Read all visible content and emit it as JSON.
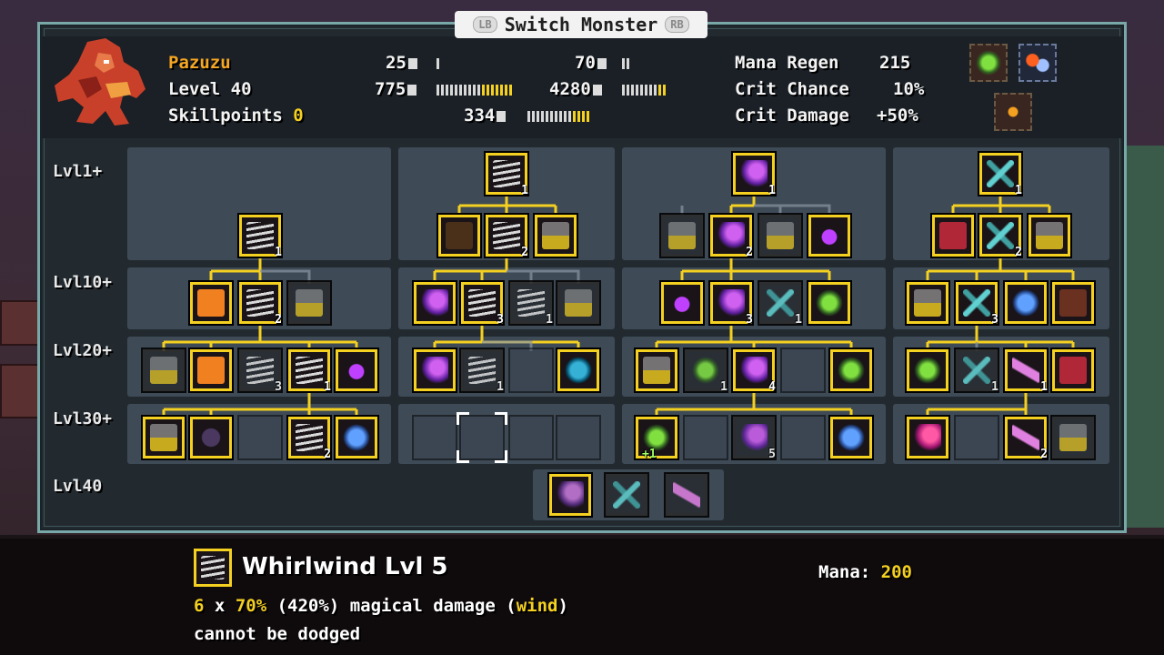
{
  "switch_bar": {
    "left_button": "LB",
    "label": "Switch Monster",
    "right_button": "RB"
  },
  "monster": {
    "name": "Pazuzu",
    "level_label": "Level 40",
    "skillpoints_label": "Skillpoints",
    "skillpoints_value": "0"
  },
  "stats": {
    "attack": "25",
    "defense": "70",
    "magic": "775",
    "health": "4280",
    "mana": "334",
    "mana_regen_label": "Mana Regen",
    "mana_regen_value": "215",
    "crit_chance_label": "Crit Chance",
    "crit_chance_value": "10%",
    "crit_damage_label": "Crit Damage",
    "crit_damage_value": "+50%"
  },
  "tiers": [
    "Lvl1+",
    "Lvl10+",
    "Lvl20+",
    "Lvl30+",
    "Lvl40"
  ],
  "node_counts": {
    "c1_t1_b": "1",
    "c1_t2_b": "2",
    "c1_t3_d": "3",
    "c1_t3_e": "1",
    "c1_t4_d": "2",
    "c2_t1": "1",
    "c2_t1_b": "2",
    "c2_t2_b": "3",
    "c2_t2_c": "1",
    "c2_t3_b": "1",
    "c3_t1": "1",
    "c3_t1_b": "2",
    "c3_t2_b": "3",
    "c3_t2_c": "1",
    "c3_t3_b": "1",
    "c3_t3_c": "4",
    "c3_t4_c": "5",
    "c4_t1": "1",
    "c4_t1_b": "2",
    "c4_t2_b": "3",
    "c4_t3_b": "1",
    "c4_t3_c": "1",
    "c4_t4_c": "2",
    "c3_t4_a": "+1"
  },
  "tooltip": {
    "title": "Whirlwind Lvl 5",
    "mana_label": "Mana:",
    "mana_value": "200",
    "hits": "6",
    "x": "x",
    "percent": "70%",
    "total": "(420%)",
    "damage_type_text": "magical damage (",
    "element": "wind",
    "close_paren": ")",
    "line2": "cannot be dodged"
  },
  "colors": {
    "accent": "#f4d020",
    "name": "#f5a623",
    "border": "#78a8a8"
  }
}
